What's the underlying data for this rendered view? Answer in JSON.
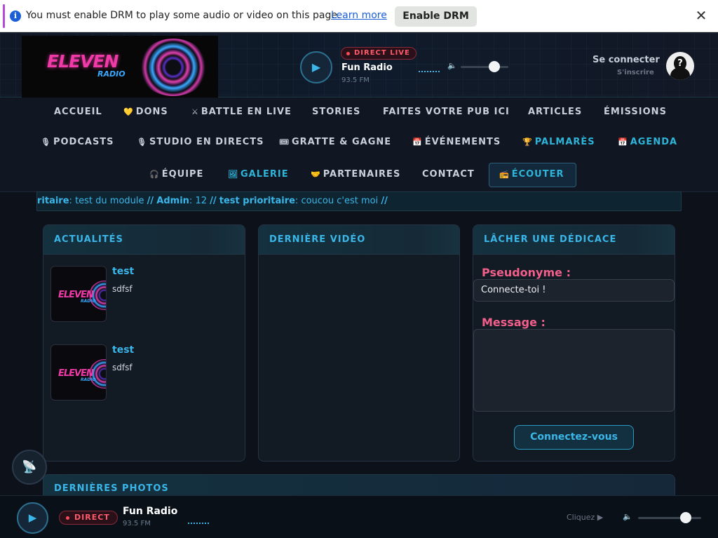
{
  "drm_bar": {
    "info_icon": "i",
    "message": "You must enable DRM to play some audio or video on this page.",
    "learn_more": "Learn more",
    "enable_button": "Enable DRM",
    "close_glyph": "✕"
  },
  "header": {
    "logo": {
      "eleven": "ELEVEN",
      "radio": "RADIO"
    },
    "live_badge": "DIRECT LIVE",
    "station": "Fun Radio",
    "frequency": "93.5 FM",
    "play_glyph": "▶",
    "volume_glyph": "🔈",
    "volume_level": 0.7,
    "login": "Se connecter",
    "signup": "S'inscrire",
    "avatar_glyph": "?"
  },
  "nav": {
    "row1": [
      {
        "label": "ACCUEIL",
        "icon": ""
      },
      {
        "label": "DONS",
        "icon": "💛"
      },
      {
        "label": "BATTLE EN LIVE",
        "icon": "⚔"
      },
      {
        "label": "STORIES",
        "icon": ""
      },
      {
        "label": "FAITES VOTRE PUB ICI",
        "icon": ""
      },
      {
        "label": "ARTICLES",
        "icon": ""
      },
      {
        "label": "ÉMISSIONS",
        "icon": ""
      }
    ],
    "row2": [
      {
        "label": "PODCASTS",
        "icon": "🎙"
      },
      {
        "label": "STUDIO EN DIRECTS",
        "icon": "🎙"
      },
      {
        "label": "GRATTE & GAGNE",
        "icon": "🎟"
      },
      {
        "label": "ÉVÉNEMENTS",
        "icon": "📅"
      },
      {
        "label": "PALMARÈS",
        "icon": "🏆"
      },
      {
        "label": "AGENDA",
        "icon": "📅"
      }
    ],
    "row3": [
      {
        "label": "ÉQUIPE",
        "icon": "🎧"
      },
      {
        "label": "GALERIE",
        "icon": "🖼"
      },
      {
        "label": "PARTENAIRES",
        "icon": "🤝"
      },
      {
        "label": "CONTACT",
        "icon": ""
      },
      {
        "label": "ÉCOUTER",
        "icon": "📻"
      }
    ]
  },
  "ticker": {
    "items": [
      {
        "author": "ritaire",
        "text": "test du module"
      },
      {
        "author": "Admin",
        "text": "12"
      },
      {
        "author": "test prioritaire",
        "text": "coucou c'est moi"
      }
    ],
    "separator": "//"
  },
  "news": {
    "title": "ACTUALITÉS",
    "items": [
      {
        "title": "test",
        "body": "sdfsf"
      },
      {
        "title": "test",
        "body": "sdfsf"
      }
    ]
  },
  "video": {
    "title": "DERNIÈRE VIDÉO"
  },
  "dedicace": {
    "title": "LÂCHER UNE DÉDICACE",
    "pseudo_label": "Pseudonyme :",
    "pseudo_value": "Connecte-toi !",
    "message_label": "Message :",
    "message_value": "",
    "submit": "Connectez-vous"
  },
  "photos": {
    "title": "DERNIÈRES PHOTOS"
  },
  "float_button": {
    "glyph": "📡"
  },
  "player": {
    "play_glyph": "▶",
    "badge": "DIRECT",
    "station": "Fun Radio",
    "frequency": "93.5 FM",
    "cliquez": "Cliquez ▶",
    "volume_glyph": "🔈",
    "volume_level": 0.75
  },
  "colors": {
    "accent": "#3ab6e8",
    "pink": "#f25f8a",
    "live_red": "#ff5a6a",
    "background": "#0c111a"
  }
}
